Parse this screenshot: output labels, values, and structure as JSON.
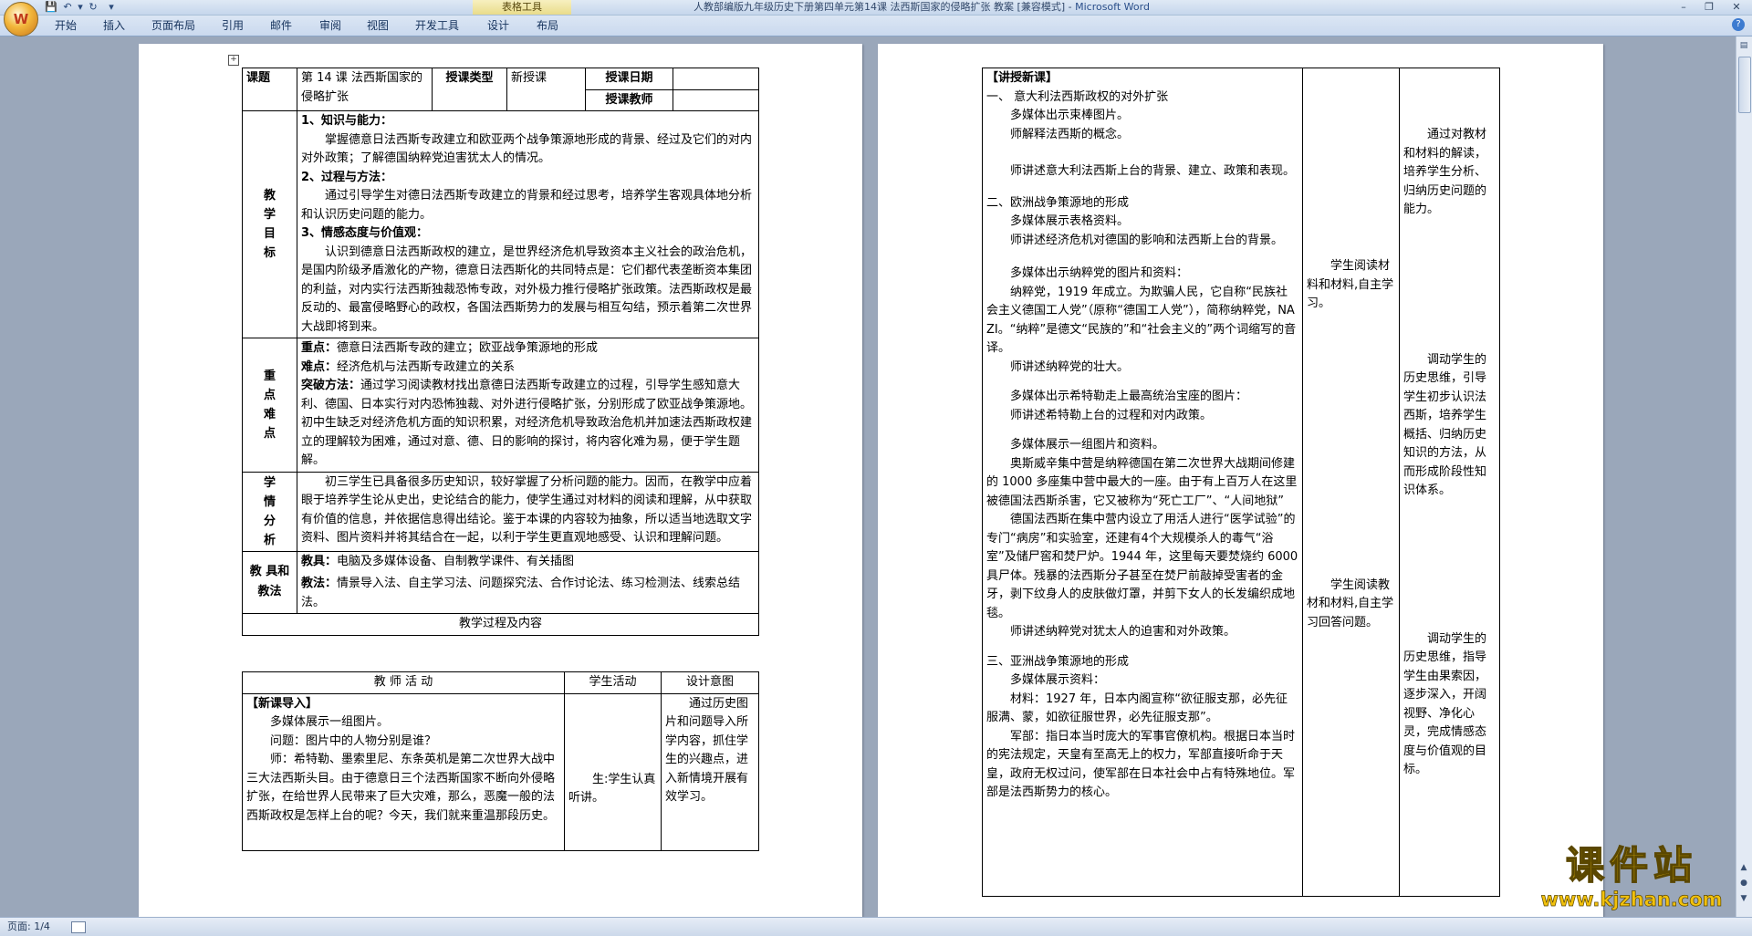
{
  "titlebar": {
    "title": "人教部编版九年级历史下册第四单元第14课 法西斯国家的侵略扩张 教案 [兼容模式] - ",
    "app": "Microsoft Word",
    "table_tools": "表格工具",
    "minimize": "–",
    "restore": "❐",
    "close": "✕"
  },
  "ribbon": {
    "tabs": [
      "开始",
      "插入",
      "页面布局",
      "引用",
      "邮件",
      "审阅",
      "视图",
      "开发工具",
      "设计",
      "布局"
    ]
  },
  "status": {
    "page": "页面: 1/4"
  },
  "lesson_table": {
    "topic_label": "课题",
    "topic_value": "第 14 课 法西斯国家的侵略扩张",
    "type_label": "授课类型",
    "type_value": "新授课",
    "date_label": "授课日期",
    "date_value": "",
    "teacher_label": "授课教师",
    "teacher_value": "",
    "goals_label": [
      "教",
      "学",
      "目",
      "标"
    ],
    "goal1_title": "1、知识与能力：",
    "goal1_text": "掌握德意日法西斯专政建立和欧亚两个战争策源地形成的背景、经过及它们的对内对外政策；了解德国纳粹党迫害犹太人的情况。",
    "goal2_title": "2、过程与方法：",
    "goal2_text": "通过引导学生对德日法西斯专政建立的背景和经过思考，培养学生客观具体地分析和认识历史问题的能力。",
    "goal3_title": "3、情感态度与价值观：",
    "goal3_text": "认识到德意日法西斯政权的建立，是世界经济危机导致资本主义社会的政治危机，是国内阶级矛盾激化的产物，德意日法西斯化的共同特点是：它们都代表垄断资本集团的利益，对内实行法西斯独裁恐怖专政，对外极力推行侵略扩张政策。法西斯政权是最反动的、最富侵略野心的政权，各国法西斯势力的发展与相互勾结，预示着第二次世界大战即将到来。",
    "key_label": [
      "重",
      "点",
      "难",
      "点"
    ],
    "key_point_title": "重点：",
    "key_point": "德意日法西斯专政的建立；欧亚战争策源地的形成",
    "difficult_title": "难点：",
    "difficult": "经济危机与法西斯专政建立的关系",
    "method_title": "突破方法：",
    "method": "通过学习阅读教材找出意德日法西斯专政建立的过程，引导学生感知意大利、德国、日本实行对内恐怖独裁、对外进行侵略扩张，分别形成了欧亚战争策源地。初中生缺乏对经济危机方面的知识积累，对经济危机导致政治危机并加速法西斯政权建立的理解较为困难，通过对意、德、日的影响的探讨，将内容化难为易，便于学生题解。",
    "analysis_label": [
      "学",
      "情",
      "分",
      "析"
    ],
    "analysis": "初三学生已具备很多历史知识，较好掌握了分析问题的能力。因而，在教学中应着眼于培养学生论从史出，史论结合的能力，使学生通过对材料的阅读和理解，从中获取有价值的信息，并依据信息得出结论。鉴于本课的内容较为抽象，所以适当地选取文字资料、图片资料并将其结合在一起，以利于学生更直观地感受、认识和理解问题。",
    "tools_label": "教 具和教法",
    "tools_title": "教具：",
    "tools": "电脑及多媒体设备、自制教学课件、有关插图",
    "methods_title": "教法：",
    "methods": "情景导入法、自主学习法、问题探究法、合作讨论法、练习检测法、线索总结法。",
    "process_header": "教学过程及内容",
    "col_teacher": "教  师  活  动",
    "col_student": "学生活动",
    "col_design": "设计意图",
    "intro_title": "【新课导入】",
    "intro_line1": "多媒体展示一组图片。",
    "intro_line2": "问题：图片中的人物分别是谁？",
    "intro_line3": "师：希特勒、墨索里尼、东条英机是第二次世界大战中三大法西斯头目。由于德意日三个法西斯国家不断向外侵略扩张，在给世界人民带来了巨大灾难，那么，恶魔一般的法西斯政权是怎样上台的呢？今天，我们就来重温那段历史。",
    "intro_student": "生:学生认真听讲。",
    "intro_design": "通过历史图片和问题导入所学内容，抓住学生的兴趣点，进入新情境开展有效学习。"
  },
  "page2": {
    "section_title": "【讲授新课】",
    "s1_title": "一、 意大利法西斯政权的对外扩张",
    "s1_l1": "多媒体出示束棒图片。",
    "s1_l2": "师解释法西斯的概念。",
    "s1_l3": "师讲述意大利法西斯上台的背景、建立、政策和表现。",
    "s2_title": "二、欧洲战争策源地的形成",
    "s2_l1": "多媒体展示表格资料。",
    "s2_l2": "师讲述经济危机对德国的影响和法西斯上台的背景。",
    "s2_l3": "多媒体出示纳粹党的图片和资料：",
    "s2_l4": "纳粹党，1919 年成立。为欺骗人民，它自称“民族社会主义德国工人党”（原称“德国工人党”），简称纳粹党，NAZI。“纳粹”是德文“民族的”和“社会主义的”两个词缩写的音译。",
    "s2_l5": "师讲述纳粹党的壮大。",
    "s2_l6": "多媒体出示希特勒走上最高统治宝座的图片：",
    "s2_l7": "师讲述希特勒上台的过程和对内政策。",
    "s2_l8": "多媒体展示一组图片和资料。",
    "s2_l9": "奥斯威辛集中营是纳粹德国在第二次世界大战期间修建的 1000 多座集中营中最大的一座。由于有上百万人在这里被德国法西斯杀害，它又被称为“死亡工厂”、“人间地狱”",
    "s2_l10": "德国法西斯在集中营内设立了用活人进行“医学试验”的专门“病房”和实验室，还建有4个大规模杀人的毒气“浴室”及储尸窖和焚尸炉。1944 年，这里每天要焚烧约 6000 具尸体。残暴的法西斯分子甚至在焚尸前敲掉受害者的金牙，剥下纹身人的皮肤做灯罩，并剪下女人的长发编织成地毯。",
    "s2_l11": "师讲述纳粹党对犹太人的迫害和对外政策。",
    "s3_title": "三、亚洲战争策源地的形成",
    "s3_l1": "多媒体展示资料：",
    "s3_l2": "材料：1927 年，日本内阁宣称“欲征服支那，必先征服满、蒙，如欲征服世界，必先征服支那”。",
    "s3_l3": "军部：指日本当时庞大的军事官僚机构。根据日本当时的宪法规定，天皇有至高无上的权力，军部直接听命于天皇，政府无权过问，使军部在日本社会中占有特殊地位。军部是法西斯势力的核心。",
    "student1": "学生阅读材料和材料,自主学习。",
    "student2": "学生阅读教材和材料,自主学习回答问题。",
    "design1": "通过对教材和材料的解读，培养学生分析、归纳历史问题的能力。",
    "design2": "调动学生的历史思维，引导学生初步认识法西斯，培养学生概括、归纳历史知识的方法，从而形成阶段性知识体系。",
    "design3": "调动学生的历史思维，指导学生由果索因，逐步深入，开阔视野、净化心灵，完成情感态度与价值观的目标。"
  },
  "watermark": {
    "brand": "课件站",
    "url": "www.kjzhan.com"
  }
}
